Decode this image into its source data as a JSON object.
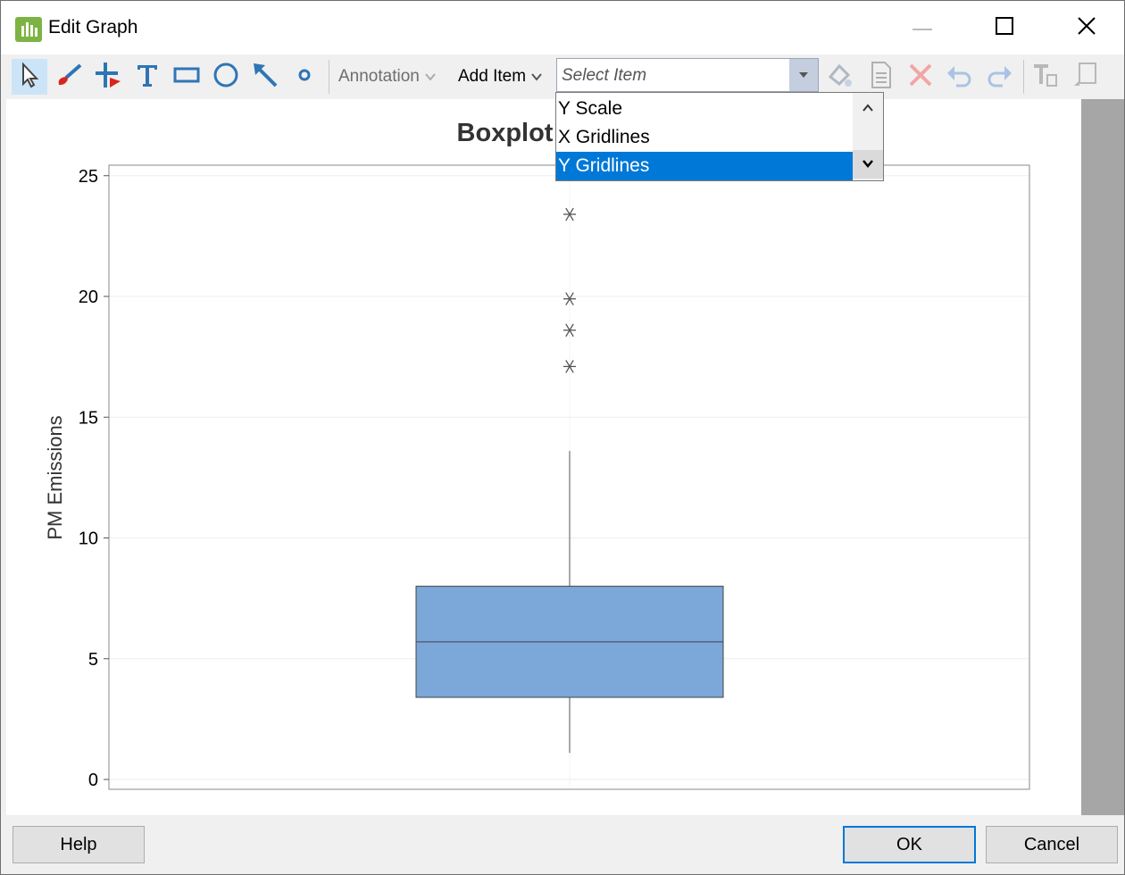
{
  "window": {
    "title": "Edit Graph",
    "controls": [
      "minimize-icon",
      "maximize-icon",
      "close-icon"
    ]
  },
  "toolbar": {
    "tools": [
      "select-arrow-icon",
      "brush-icon",
      "crosshair-icon",
      "text-icon",
      "rectangle-icon",
      "ellipse-icon",
      "line-arrow-icon",
      "point-icon"
    ],
    "annotation_label": "Annotation",
    "add_item_label": "Add Item",
    "select_item_placeholder": "Select Item",
    "edit_tools": [
      "format-paint-icon",
      "properties-icon",
      "delete-icon",
      "undo-icon",
      "redo-icon",
      "text-format-icon",
      "copy-layout-icon"
    ]
  },
  "dropdown": {
    "items": [
      "Y Scale",
      "X Gridlines",
      "Y Gridlines"
    ],
    "selected": "Y Gridlines"
  },
  "chart_data": {
    "type": "boxplot",
    "title": "Boxplot of PM",
    "ylabel": "PM Emissions",
    "xlabel": "",
    "ylim": [
      0,
      25
    ],
    "yticks": [
      0,
      5,
      10,
      15,
      20,
      25
    ],
    "box": {
      "whisker_low": 1.1,
      "q1": 3.4,
      "median": 5.7,
      "q3": 8.0,
      "whisker_high": 13.6
    },
    "outliers": [
      17.1,
      18.6,
      19.9,
      23.4
    ],
    "box_color": "#7ba7d9",
    "grid": true
  },
  "buttons": {
    "help": "Help",
    "ok": "OK",
    "cancel": "Cancel"
  },
  "colors": {
    "selection": "#0078d7",
    "app_icon": "#7cb342"
  }
}
